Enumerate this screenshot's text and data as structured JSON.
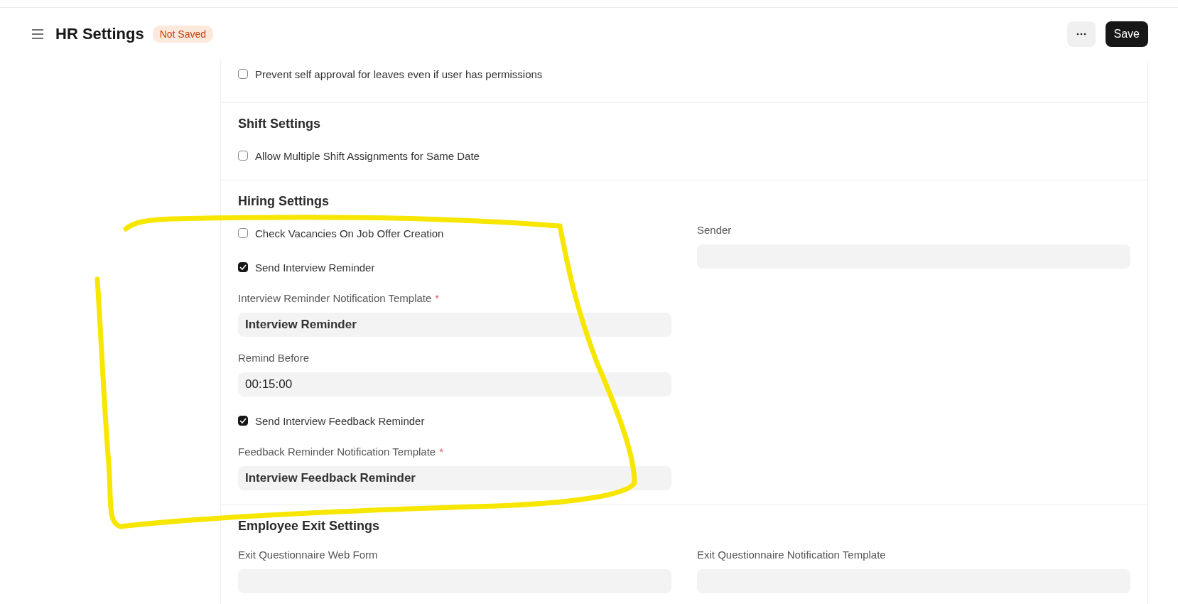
{
  "header": {
    "title": "HR Settings",
    "status_badge": "Not Saved",
    "save_button": "Save"
  },
  "required_symbol": "*",
  "sections": [
    {
      "columns": [
        [
          {
            "kind": "checkbox",
            "label": "Prevent self approval for leaves even if user has permissions",
            "checked": false
          }
        ]
      ]
    },
    {
      "title": "Shift Settings",
      "columns": [
        [
          {
            "kind": "checkbox",
            "label": "Allow Multiple Shift Assignments for Same Date",
            "checked": false
          }
        ]
      ]
    },
    {
      "title": "Hiring Settings",
      "columns": [
        [
          {
            "kind": "checkbox",
            "label": "Check Vacancies On Job Offer Creation",
            "checked": false
          },
          {
            "kind": "checkbox",
            "label": "Send Interview Reminder",
            "checked": true
          },
          {
            "kind": "link",
            "label": "Interview Reminder Notification Template",
            "required": true,
            "value": "Interview Reminder"
          },
          {
            "kind": "data",
            "label": "Remind Before",
            "required": false,
            "value": "00:15:00"
          },
          {
            "kind": "checkbox",
            "label": "Send Interview Feedback Reminder",
            "checked": true
          },
          {
            "kind": "link",
            "label": "Feedback Reminder Notification Template",
            "required": true,
            "value": "Interview Feedback Reminder"
          }
        ],
        [
          {
            "kind": "data",
            "label": "Sender",
            "required": false
          }
        ]
      ]
    },
    {
      "title": "Employee Exit Settings",
      "columns": [
        [
          {
            "kind": "link",
            "label": "Exit Questionnaire Web Form",
            "required": false
          }
        ],
        [
          {
            "kind": "link",
            "label": "Exit Questionnaire Notification Template",
            "required": false
          }
        ]
      ]
    }
  ]
}
